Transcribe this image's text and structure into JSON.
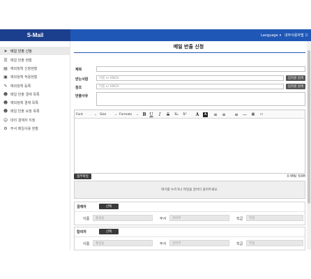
{
  "brand": "S-Mail",
  "topbar": {
    "language_label": "Language",
    "language_icon": "caret-down-icon",
    "user_directory_label": "내부사용자맵",
    "user_directory_icon": "exit-icon"
  },
  "sidebar": {
    "items": [
      {
        "label": "메일 반출 신청",
        "icon": "paper-plane-icon",
        "active": true
      },
      {
        "label": "메일 반출 현황",
        "icon": "list-icon"
      },
      {
        "label": "예외정책 신청현황",
        "icon": "clipboard-icon"
      },
      {
        "label": "예외정책 적용현황",
        "icon": "clipboard-check-icon"
      },
      {
        "label": "예외정책 등록",
        "icon": "edit-icon"
      },
      {
        "label": "메일 반출 결재 목록",
        "icon": "user-check-icon"
      },
      {
        "label": "예외정책 결재 목록",
        "icon": "user-check-icon"
      },
      {
        "label": "메일 반출 요청 목록",
        "icon": "user-list-icon"
      },
      {
        "label": "대리 결재자 지정",
        "icon": "user-plus-icon"
      },
      {
        "label": "부서 메일사용 현황",
        "icon": "gear-icon"
      }
    ]
  },
  "main": {
    "title": "메일 반출 신청",
    "form": {
      "subject_label": "제목",
      "subject_value": "",
      "recipient_label": "받는사람",
      "recipient_placeholder": "이름 or KNOX",
      "cc_label": "참조",
      "cc_placeholder": "이름 or KNOX",
      "reason_label": "반출사유",
      "reason_value": "",
      "org_search_label": "임직원 검색"
    },
    "editor": {
      "font_select": "Font",
      "size_select": "Size",
      "format_select": "Formats",
      "buttons": [
        {
          "glyph": "B",
          "icon": "bold-icon"
        },
        {
          "glyph": "U",
          "icon": "underline-icon"
        },
        {
          "glyph": "I",
          "icon": "italic-icon"
        },
        {
          "glyph": "S",
          "icon": "strikethrough-icon"
        },
        {
          "glyph": "X₂",
          "icon": "subscript-icon"
        },
        {
          "glyph": "X²",
          "icon": "superscript-icon"
        },
        {
          "glyph": "A",
          "icon": "text-color-icon"
        },
        {
          "glyph": "A",
          "icon": "background-color-icon"
        },
        {
          "glyph": "≡",
          "icon": "ordered-list-icon"
        },
        {
          "glyph": "≡",
          "icon": "bullet-list-icon"
        },
        {
          "glyph": "≡",
          "icon": "align-icon"
        },
        {
          "glyph": "—",
          "icon": "horizontal-rule-icon"
        },
        {
          "glyph": "▦",
          "icon": "table-icon"
        },
        {
          "glyph": "▭",
          "icon": "image-icon"
        }
      ]
    },
    "attachment": {
      "button_label": "첨부파일",
      "size_text": "0 MB/ 50M",
      "dropzone_text": "여기를 누르거나 파일을 끌어다 올려주세요."
    },
    "approver": {
      "title": "결재자",
      "select_label": "선택",
      "name_label": "이름",
      "name_placeholder": "홍길동",
      "dept_label": "부서",
      "dept_placeholder": "관리부",
      "position_label": "직급",
      "position_placeholder": "부장"
    },
    "agreer": {
      "title": "합의자",
      "select_label": "선택",
      "name_label": "이름",
      "name_placeholder": "홍길동",
      "dept_label": "부서",
      "dept_placeholder": "관리부",
      "position_label": "직급",
      "position_placeholder": "부장"
    }
  }
}
